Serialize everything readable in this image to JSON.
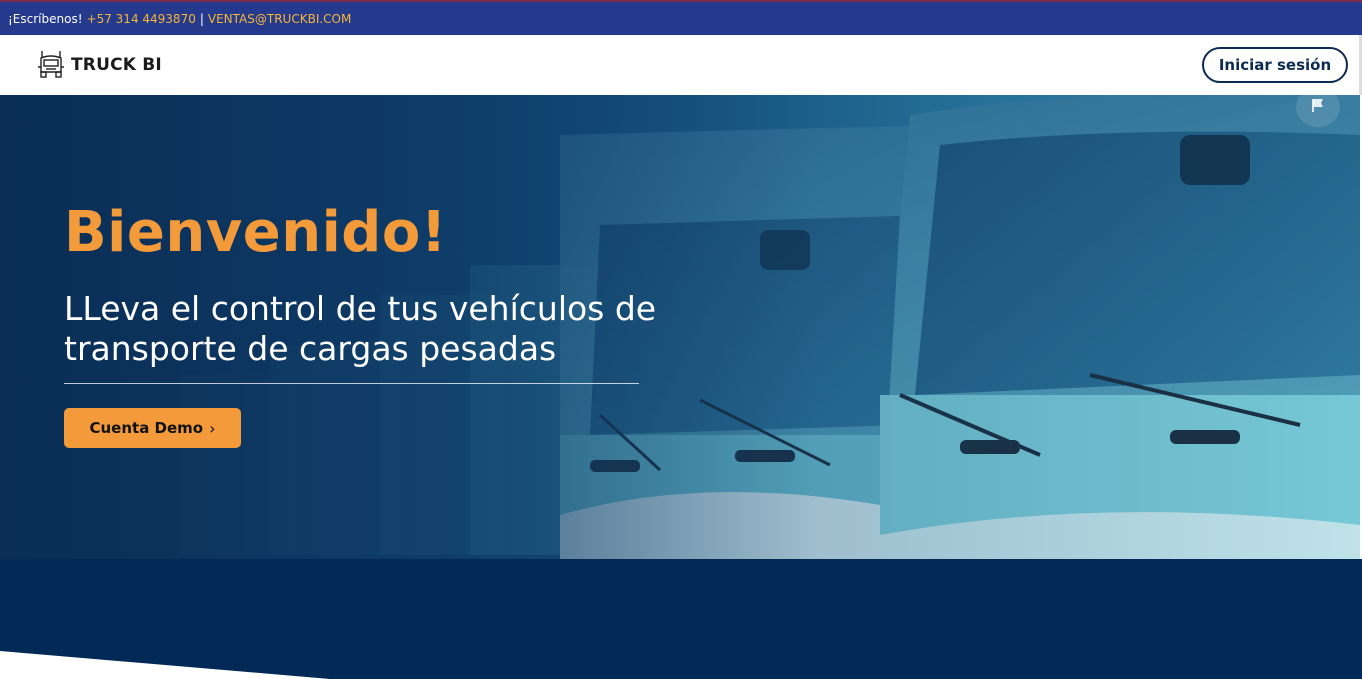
{
  "topbar": {
    "prefix": "¡Escríbenos!",
    "phone": "+57 314 4493870",
    "separator": "|",
    "email": "VENTAS@TRUCKBI.COM"
  },
  "navbar": {
    "brand_name": "TRUCK BI",
    "brand_icon": "truck-icon",
    "login_label": "Iniciar sesión"
  },
  "hero": {
    "title": "Bienvenido!",
    "subtitle": "LLeva el control de tus vehículos de transporte de cargas pesadas",
    "cta_label": "Cuenta Demo",
    "cta_icon": "chevron-right-icon",
    "flag_icon": "flag-icon",
    "image_icon": "trucks-photo"
  },
  "colors": {
    "topbar_bg": "#253a8c",
    "topbar_accent": "#f4b63c",
    "brand_dark": "#0c2b52",
    "accent_orange": "#f39a3a",
    "section_navy": "#032a57"
  }
}
